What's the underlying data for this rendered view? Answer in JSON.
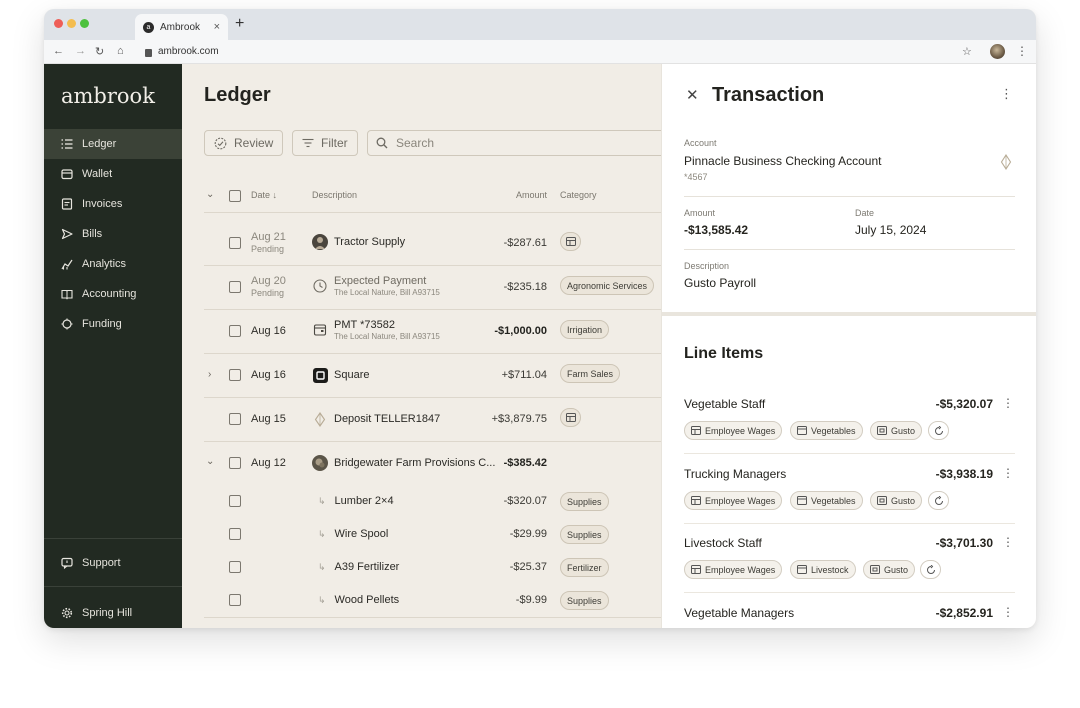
{
  "browser": {
    "tab_title": "Ambrook",
    "tab_close": "×",
    "new_tab": "+",
    "url": "ambrook.com",
    "traffic_colors": [
      "#ee5e57",
      "#f4bd4f",
      "#4cc13d"
    ]
  },
  "sidebar": {
    "logo": "ambrook",
    "items": [
      {
        "label": "Ledger",
        "icon": "list-icon",
        "active": true
      },
      {
        "label": "Wallet",
        "icon": "wallet-icon"
      },
      {
        "label": "Invoices",
        "icon": "invoice-icon"
      },
      {
        "label": "Bills",
        "icon": "send-icon"
      },
      {
        "label": "Analytics",
        "icon": "analytics-icon"
      },
      {
        "label": "Accounting",
        "icon": "book-icon"
      },
      {
        "label": "Funding",
        "icon": "funding-icon"
      }
    ],
    "support": "Support",
    "workspace": "Spring Hill"
  },
  "ledger": {
    "title": "Ledger",
    "review": "Review",
    "filter": "Filter",
    "search_placeholder": "Search",
    "columns": {
      "date": "Date ↓",
      "description": "Description",
      "amount": "Amount",
      "category": "Category"
    },
    "rows": [
      {
        "date": "Aug 21",
        "status": "Pending",
        "description": "Tractor Supply",
        "amount": "-$287.61",
        "category": "",
        "icon": "avatar"
      },
      {
        "date": "Aug 20",
        "status": "Pending",
        "description": "Expected Payment",
        "note": "The Local Nature, Bill A93715",
        "amount": "-$235.18",
        "category": "Agronomic Services",
        "icon": "clock-icon"
      },
      {
        "date": "Aug 16",
        "description": "PMT *73582",
        "note": "The Local Nature, Bill A93715",
        "amount": "-$1,000.00",
        "category": "Irrigation",
        "icon": "wallet-icon"
      },
      {
        "date": "Aug 16",
        "description": "Square",
        "amount": "+$711.04",
        "category": "Farm Sales",
        "icon": "square-logo"
      },
      {
        "date": "Aug 15",
        "description": "Deposit TELLER1847",
        "amount": "+$3,879.75",
        "category": "",
        "icon": "bank-icon"
      },
      {
        "date": "Aug 12",
        "description": "Bridgewater Farm Provisions C...",
        "amount": "-$385.42",
        "category": "",
        "icon": "avatar"
      },
      {
        "date": "",
        "description": "Lumber 2×4",
        "amount": "-$320.07",
        "category": "Supplies",
        "split": true
      },
      {
        "date": "",
        "description": "Wire Spool",
        "amount": "-$29.99",
        "category": "Supplies",
        "split": true
      },
      {
        "date": "",
        "description": "A39 Fertilizer",
        "amount": "-$25.37",
        "category": "Fertilizer",
        "split": true
      },
      {
        "date": "",
        "description": "Wood Pellets",
        "amount": "-$9.99",
        "category": "Supplies",
        "split": true
      }
    ]
  },
  "transaction": {
    "title": "Transaction",
    "account_label": "Account",
    "account_name": "Pinnacle Business Checking Account",
    "account_number": "*4567",
    "amount_label": "Amount",
    "amount": "-$13,585.42",
    "date_label": "Date",
    "date": "July 15, 2024",
    "description_label": "Description",
    "description": "Gusto Payroll",
    "line_items_title": "Line Items",
    "line_items": [
      {
        "name": "Vegetable Staff",
        "amount": "-$5,320.07",
        "tags": [
          "Employee Wages",
          "Vegetables",
          "Gusto"
        ]
      },
      {
        "name": "Trucking Managers",
        "amount": "-$3,938.19",
        "tags": [
          "Employee Wages",
          "Vegetables",
          "Gusto"
        ]
      },
      {
        "name": "Livestock Staff",
        "amount": "-$3,701.30",
        "tags": [
          "Employee Wages",
          "Livestock",
          "Gusto"
        ]
      },
      {
        "name": "Vegetable Managers",
        "amount": "-$2,852.91",
        "tags": []
      }
    ]
  }
}
